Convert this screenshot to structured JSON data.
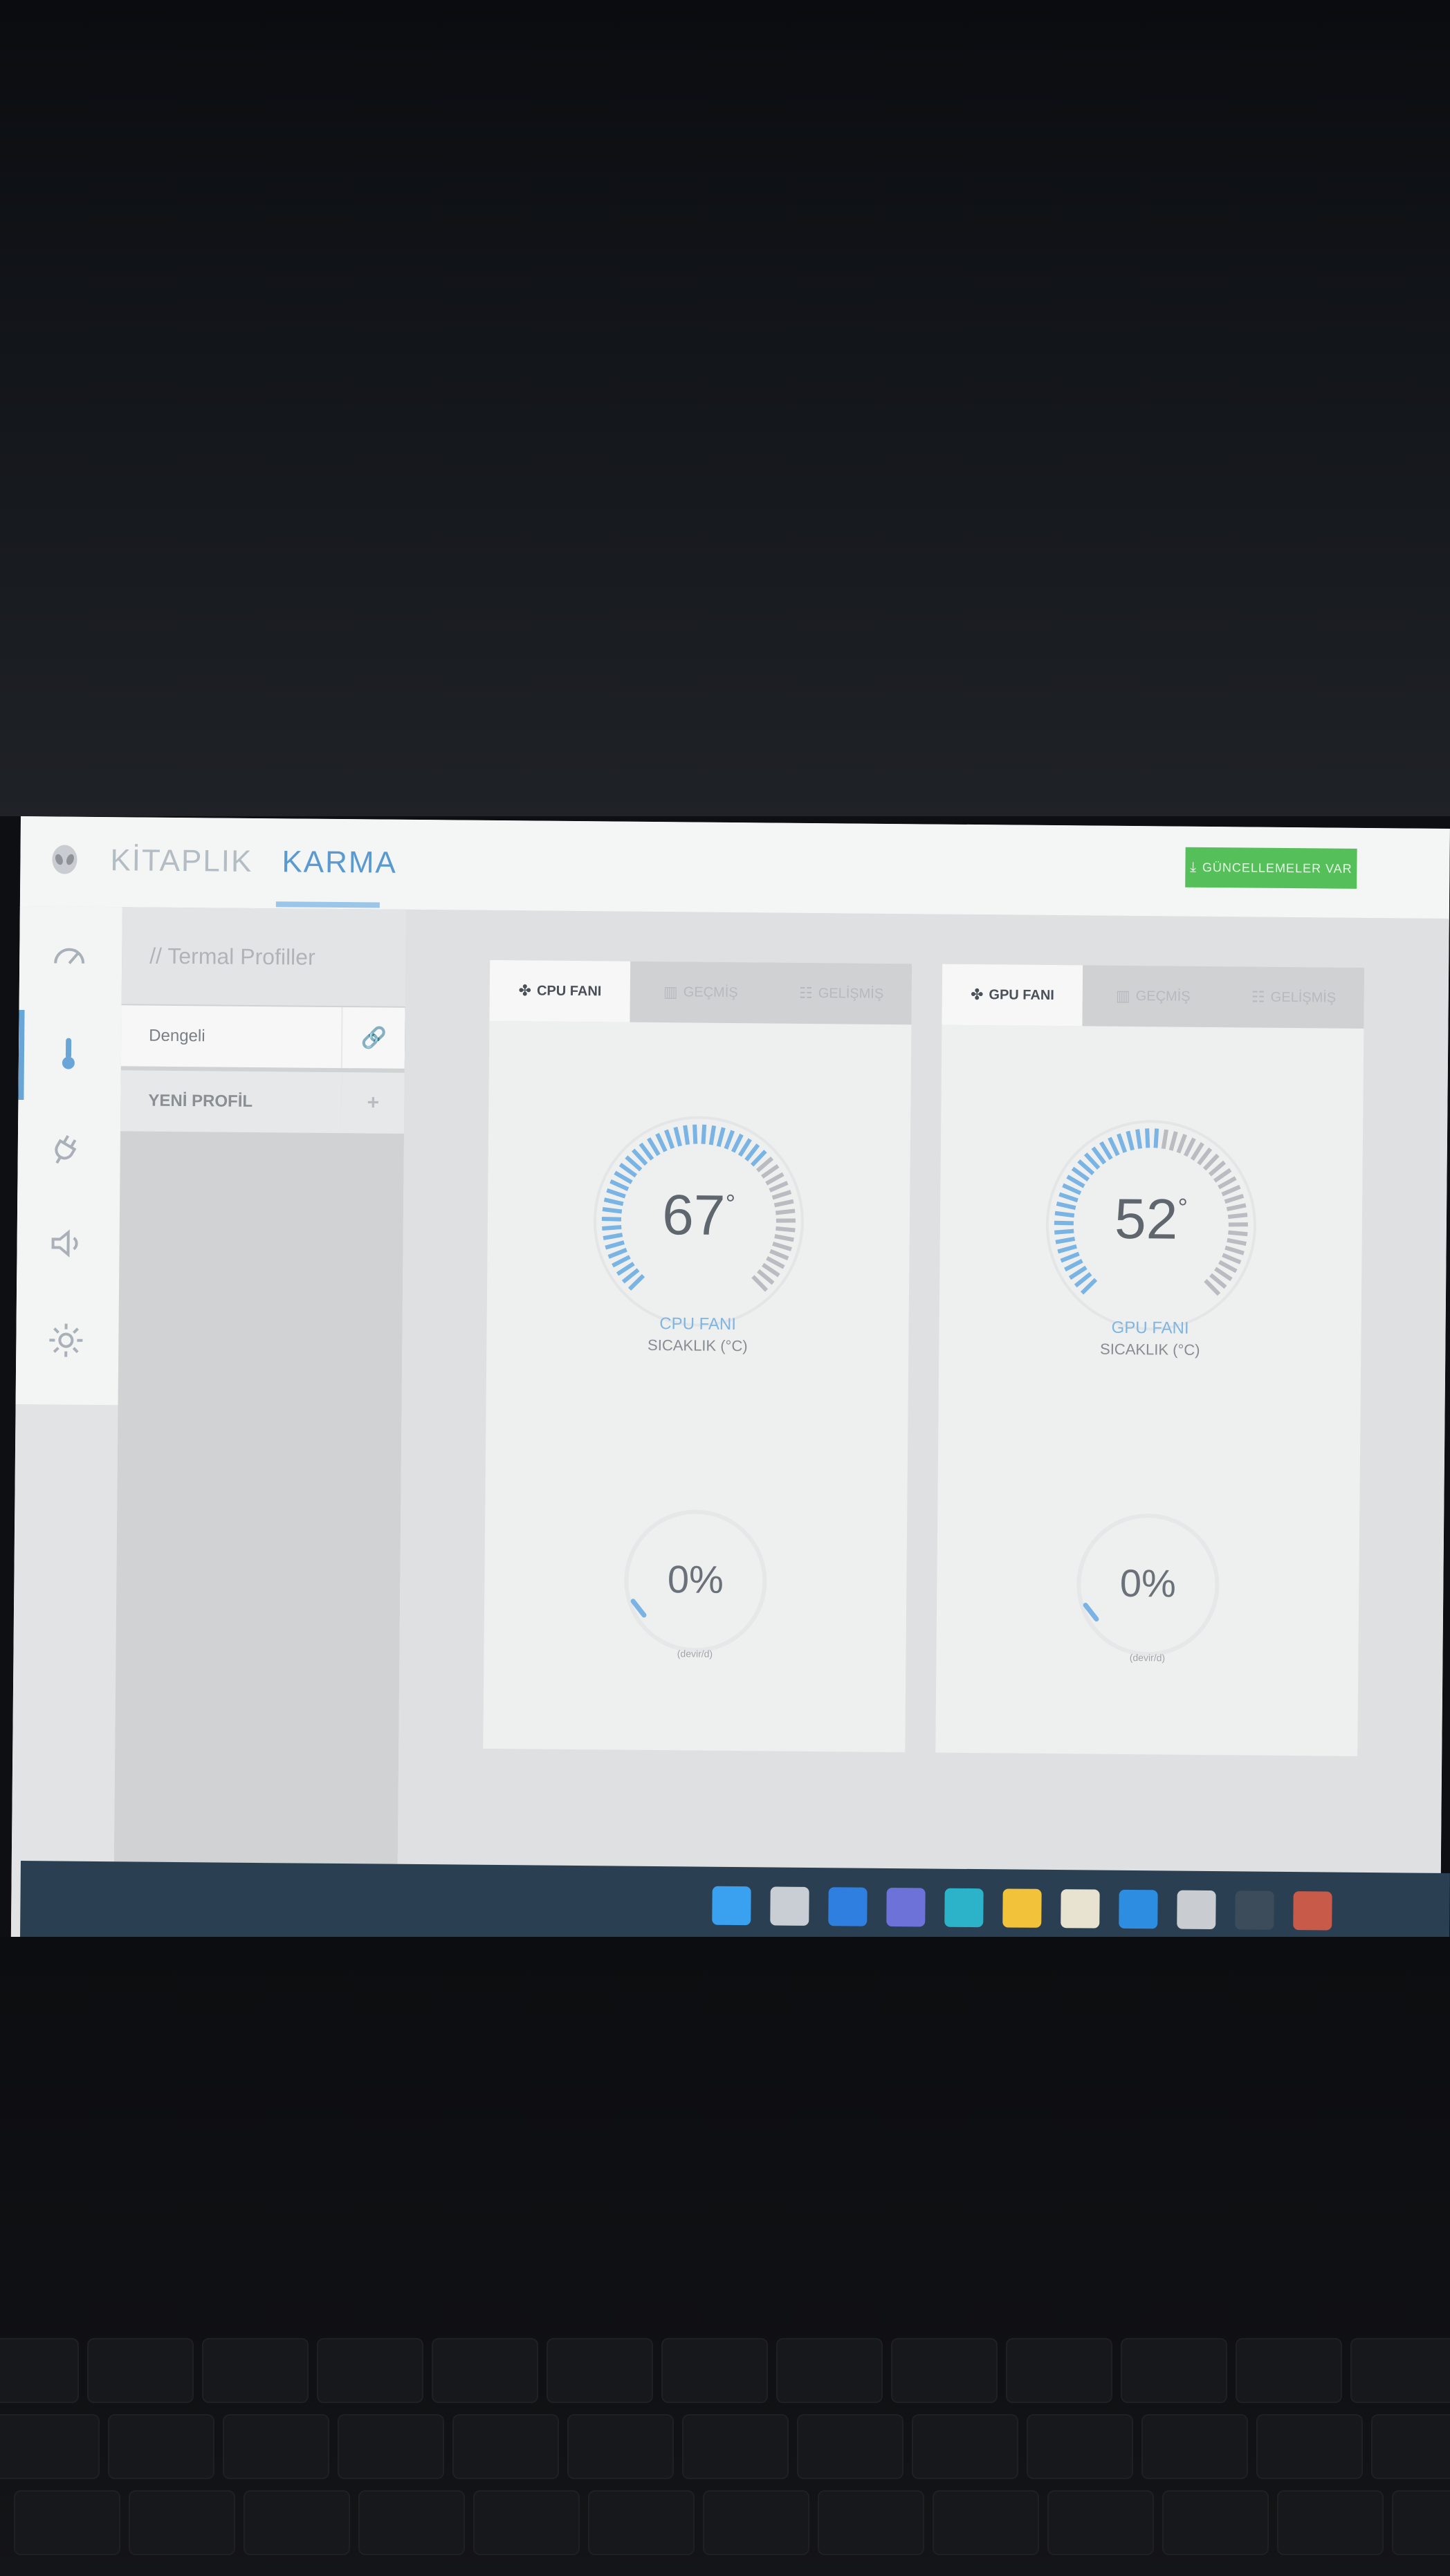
{
  "app": {
    "nav_tabs": [
      {
        "label": "KİTAPLIK",
        "active": false
      },
      {
        "label": "KARMA",
        "active": true
      }
    ],
    "update_button": "GÜNCELLEMELER VAR"
  },
  "rail": {
    "items": [
      {
        "icon": "performance-gauge-icon"
      },
      {
        "icon": "thermometer-icon",
        "active": true
      },
      {
        "icon": "power-plug-icon"
      },
      {
        "icon": "speaker-icon"
      },
      {
        "icon": "brightness-icon"
      }
    ]
  },
  "profiles": {
    "title": "// Termal Profiller",
    "items": [
      {
        "label": "Dengeli",
        "action_icon": "link-icon",
        "action_symbol": "🔗",
        "selected": true
      },
      {
        "label": "YENİ PROFİL",
        "action_icon": "plus-icon",
        "action_symbol": "+"
      }
    ]
  },
  "cards": [
    {
      "tabs": [
        {
          "label": "CPU FANI",
          "icon": "fan-icon",
          "symbol": "✤",
          "active": true
        },
        {
          "label": "GEÇMİŞ",
          "icon": "history-chart-icon",
          "symbol": "▥"
        },
        {
          "label": "GELİŞMİŞ",
          "icon": "sliders-icon",
          "symbol": "☷"
        }
      ],
      "temperature": "67",
      "temperature_fraction": 0.67,
      "degree_symbol": "°",
      "gauge_label": "CPU FANI",
      "gauge_sub": "SICAKLIK (°C)",
      "fan_percent": "0%",
      "fan_rpm": "(devir/d)"
    },
    {
      "tabs": [
        {
          "label": "GPU FANI",
          "icon": "fan-icon",
          "symbol": "✤",
          "active": true
        },
        {
          "label": "GEÇMİŞ",
          "icon": "history-chart-icon",
          "symbol": "▥"
        },
        {
          "label": "GELİŞMİŞ",
          "icon": "sliders-icon",
          "symbol": "☷"
        }
      ],
      "temperature": "52",
      "temperature_fraction": 0.52,
      "degree_symbol": "°",
      "gauge_label": "GPU FANI",
      "gauge_sub": "SICAKLIK (°C)",
      "fan_percent": "0%",
      "fan_rpm": "(devir/d)"
    }
  ],
  "taskbar": {
    "icons": [
      {
        "name": "start-icon",
        "color": "#3aa0f0"
      },
      {
        "name": "search-icon",
        "color": "#c9ced4"
      },
      {
        "name": "widgets-icon",
        "color": "#2f7fe0"
      },
      {
        "name": "chat-icon",
        "color": "#6c72d8"
      },
      {
        "name": "edge-browser-icon",
        "color": "#2db3c9"
      },
      {
        "name": "file-explorer-icon",
        "color": "#f2c23a"
      },
      {
        "name": "store-icon",
        "color": "#e8e2d0"
      },
      {
        "name": "mail-icon",
        "color": "#2d8de0"
      },
      {
        "name": "dell-icon",
        "color": "#c9cdd2"
      },
      {
        "name": "alienware-icon",
        "color": "#3c4c5a",
        "running": true
      },
      {
        "name": "app-icon",
        "color": "#c85a4a"
      }
    ]
  },
  "colors": {
    "accent": "#6aa5d8",
    "update_green": "#55c05a",
    "gauge_active": "#7ab4e4",
    "gauge_inactive": "#b9bdc1"
  }
}
